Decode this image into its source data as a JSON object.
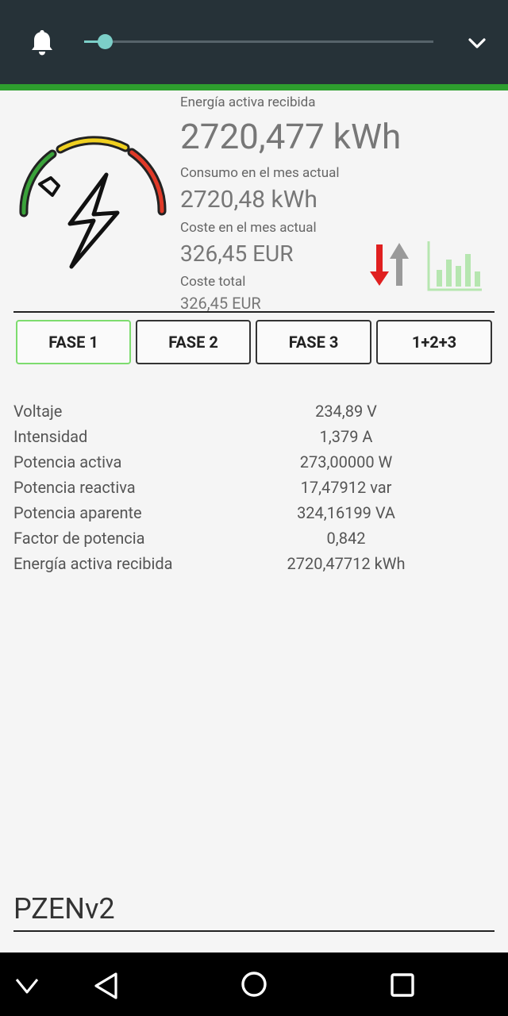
{
  "status_bar": {
    "slider_value_fraction": 0.06
  },
  "summary": {
    "energia_label": "Energía activa recibida",
    "energia_value": "2720,477 kWh",
    "consumo_label": "Consumo en el mes actual",
    "consumo_value": "2720,48 kWh",
    "coste_mes_label": "Coste en el mes actual",
    "coste_mes_value": "326,45 EUR",
    "coste_total_label": "Coste total",
    "coste_total_value": "326,45 EUR"
  },
  "phase_tabs": [
    {
      "label": "FASE 1",
      "active": true
    },
    {
      "label": "FASE 2",
      "active": false
    },
    {
      "label": "FASE 3",
      "active": false
    },
    {
      "label": "1+2+3",
      "active": false
    }
  ],
  "measurements": [
    {
      "label": "Voltaje",
      "value": "234,89 V"
    },
    {
      "label": "Intensidad",
      "value": "1,379 A"
    },
    {
      "label": "Potencia activa",
      "value": "273,00000 W"
    },
    {
      "label": "Potencia reactiva",
      "value": "17,47912 var"
    },
    {
      "label": "Potencia aparente",
      "value": "324,16199 VA"
    },
    {
      "label": "Factor de potencia",
      "value": "0,842"
    },
    {
      "label": "Energía activa recibida",
      "value": "2720,47712 kWh"
    }
  ],
  "device_name": "PZENv2",
  "colors": {
    "topbar": "#263238",
    "accent_green": "#2e9e2e",
    "slider": "#7ccfc8",
    "active_tab_border": "#7ddc6e",
    "arrow_down": "#e02020",
    "arrow_up": "#999999",
    "chart_icon": "#b6e6b0"
  },
  "icons": {
    "notifications": "bell-icon",
    "expand": "chevron-down-icon",
    "power_gauge": "gauge-lightning-icon",
    "flow_direction": "up-down-arrows-icon",
    "history": "bar-chart-icon",
    "nav_back": "back-triangle-icon",
    "nav_home": "home-circle-icon",
    "nav_recents": "recents-square-icon",
    "nav_hide": "hide-keyboard-chevron-icon"
  }
}
